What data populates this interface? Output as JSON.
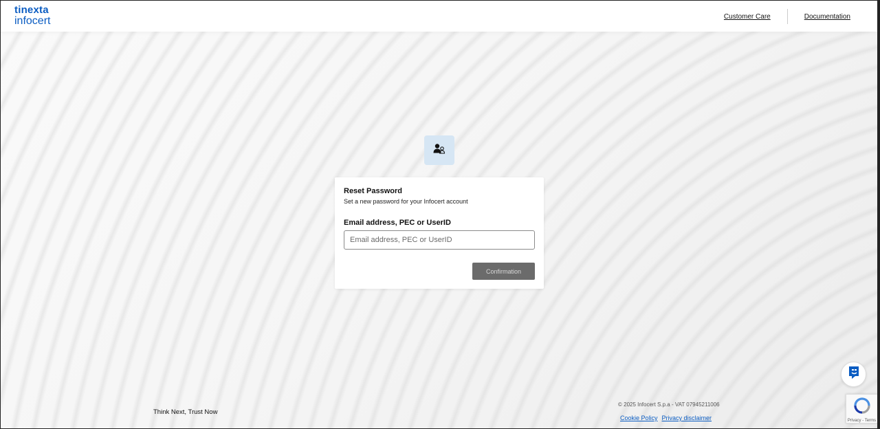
{
  "header": {
    "logo_top": "tinexta",
    "logo_bottom": "infocert",
    "nav": [
      "Customer Care",
      "Documentation"
    ]
  },
  "card": {
    "title": "Reset Password",
    "subtitle": "Set a new password for your Infocert account",
    "field_label": "Email address, PEC or UserID",
    "field_placeholder": "Email address, PEC or UserID",
    "field_value": "",
    "confirm_label": "Confirmation"
  },
  "footer": {
    "tagline": "Think Next, Trust Now",
    "copyright": "© 2025 Infocert S.p.a - VAT 07945211006",
    "links": [
      "Cookie Policy",
      "Privacy disclaimer"
    ]
  },
  "recaptcha": {
    "text": "Privacy - Terms"
  },
  "icons": {
    "avatar": "user-icon",
    "chat": "chat-bot-icon",
    "recaptcha": "recaptcha-icon"
  },
  "colors": {
    "brand": "#0a5cc2",
    "avatar_tile": "#d6e6f4",
    "button_disabled": "#6b6b6b"
  }
}
